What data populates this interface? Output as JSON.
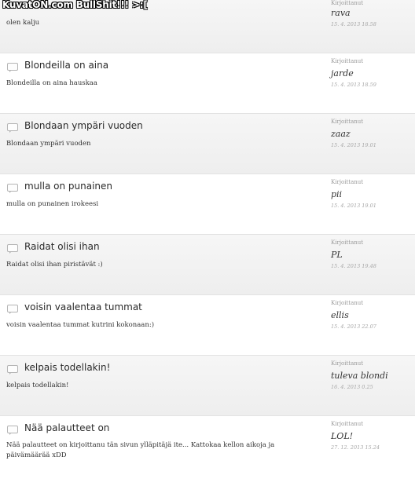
{
  "watermark": "KuvatON.com BullShit!!! >:[",
  "meta_label": "Kirjoittanut",
  "posts": [
    {
      "title": "",
      "body": "olen kalju",
      "author": "rava",
      "date": "15. 4. 2013 18.58"
    },
    {
      "title": "Blondeilla on aina",
      "body": "Blondeilla on aina hauskaa",
      "author": "jarde",
      "date": "15. 4. 2013 18.59"
    },
    {
      "title": "Blondaan ympäri vuoden",
      "body": "Blondaan ympäri vuoden",
      "author": "zaaz",
      "date": "15. 4. 2013 19.01"
    },
    {
      "title": "mulla on punainen",
      "body": "mulla on punainen irokeesi",
      "author": "pii",
      "date": "15. 4. 2013 19.01"
    },
    {
      "title": "Raidat olisi ihan",
      "body": "Raidat olisi ihan piristävät :)",
      "author": "PL",
      "date": "15. 4. 2013 19.48"
    },
    {
      "title": "voisin vaalentaa tummat",
      "body": "voisin vaalentaa tummat kutrini kokonaan:)",
      "author": "ellis",
      "date": "15. 4. 2013 22.07"
    },
    {
      "title": "kelpais todellakin!",
      "body": "kelpais todellakin!",
      "author": "tuleva blondi",
      "date": "16. 4. 2013 0.25"
    },
    {
      "title": "Nää palautteet on",
      "body": "Nää palautteet on kirjoittanu tän sivun ylläpitäjä ite... Kattokaa kellon aikoja ja päivämäärää xDD",
      "author": "LOL!",
      "date": "27. 12. 2013 15.24"
    }
  ]
}
